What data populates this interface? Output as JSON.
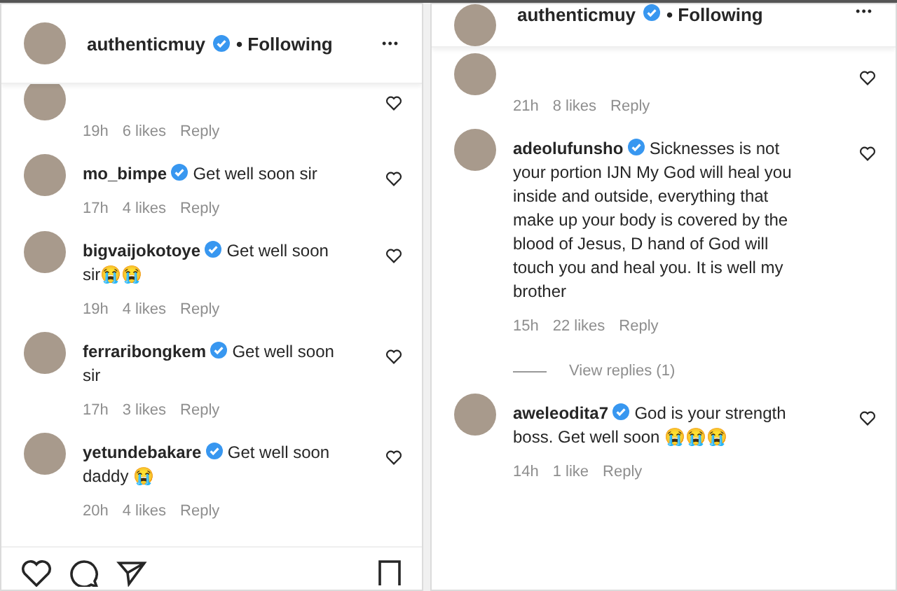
{
  "panels": [
    {
      "header": {
        "username": "authenticmuy",
        "verified": true,
        "status": "• Following",
        "more": "•••"
      },
      "comments": [
        {
          "clipped": true,
          "time": "19h",
          "likes": "6 likes",
          "reply": "Reply",
          "liked": false
        },
        {
          "username": "mo_bimpe",
          "verified": true,
          "text": "Get well soon sir",
          "time": "17h",
          "likes": "4 likes",
          "reply": "Reply",
          "liked": false
        },
        {
          "username": "bigvaijokotoye",
          "verified": true,
          "text": "Get well soon sir😭😭",
          "time": "19h",
          "likes": "4 likes",
          "reply": "Reply",
          "liked": false
        },
        {
          "username": "ferraribongkem",
          "verified": true,
          "text": "Get well soon sir",
          "time": "17h",
          "likes": "3 likes",
          "reply": "Reply",
          "liked": false
        },
        {
          "username": "yetundebakare",
          "verified": true,
          "text": "Get well soon daddy 😭",
          "time": "20h",
          "likes": "4 likes",
          "reply": "Reply",
          "liked": false
        }
      ],
      "action_bar": true
    },
    {
      "header": {
        "username": "authenticmuy",
        "verified": true,
        "status": "• Following",
        "more": "•••"
      },
      "comments": [
        {
          "clipped": true,
          "time": "21h",
          "likes": "8 likes",
          "reply": "Reply",
          "liked": false
        },
        {
          "username": "adeolufunsho",
          "verified": true,
          "text": "Sicknesses is not your portion IJN My God will heal you inside and outside, everything that make up your body is covered by the blood of Jesus, D hand of God will touch you and heal you. It is well my brother",
          "time": "15h",
          "likes": "22 likes",
          "reply": "Reply",
          "liked": false,
          "view_replies": "View replies (1)"
        },
        {
          "username": "aweleodita7",
          "verified": true,
          "text": "God is your strength boss. Get well soon 😭😭😭",
          "time": "14h",
          "likes": "1 like",
          "reply": "Reply",
          "liked": false
        }
      ],
      "action_bar": false
    }
  ]
}
